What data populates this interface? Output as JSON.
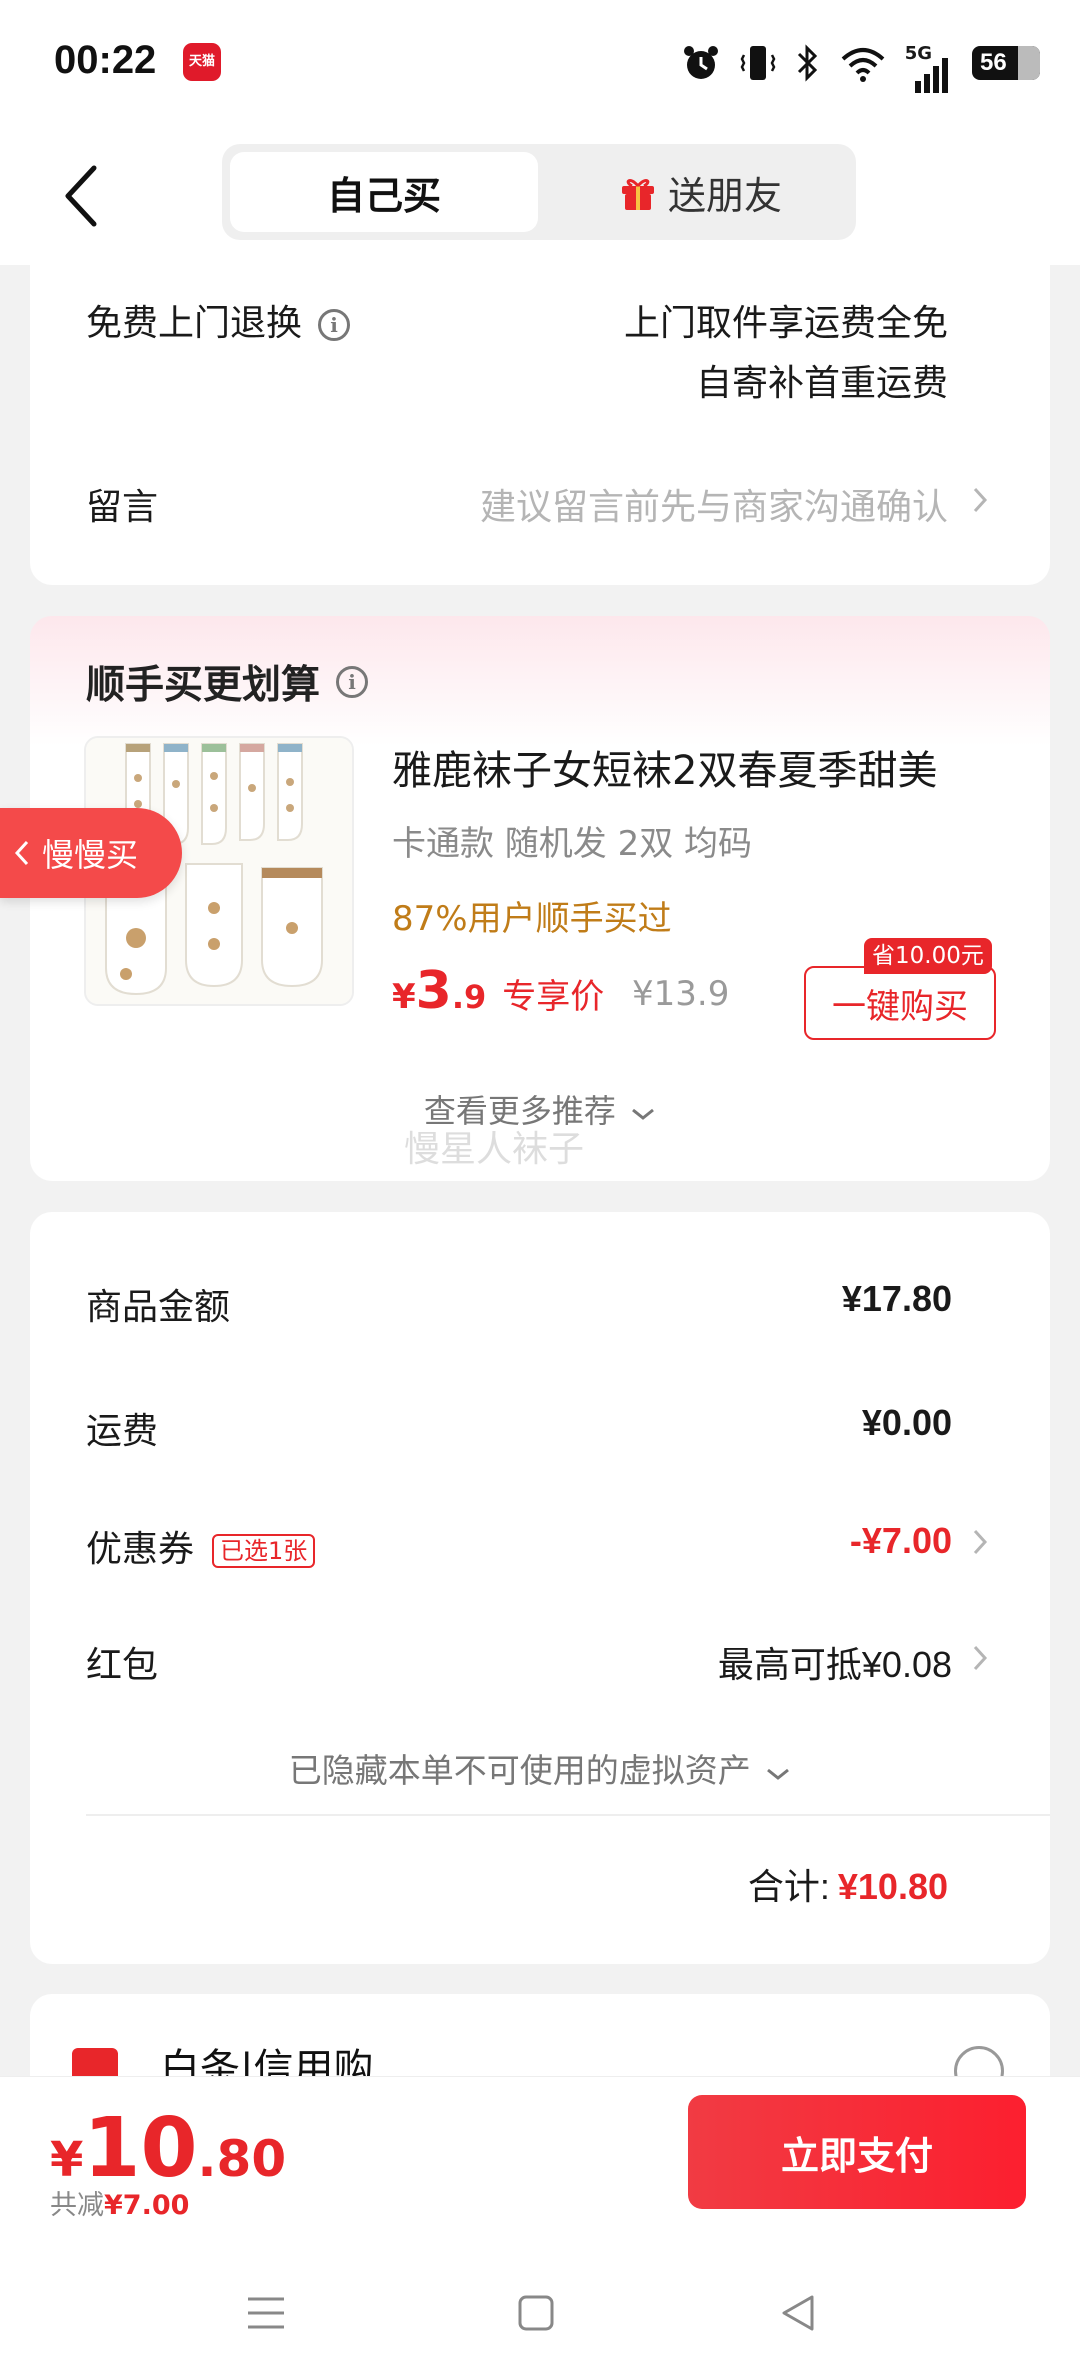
{
  "status_bar": {
    "time": "00:22",
    "app_badge": "天猫",
    "network": "5G",
    "battery": "56"
  },
  "nav": {
    "tab_self": "自己买",
    "tab_gift": "送朋友"
  },
  "service": {
    "free_return_label": "免费上门退换",
    "free_return_line1": "上门取件享运费全免",
    "free_return_line2": "自寄补首重运费",
    "message_label": "留言",
    "message_placeholder": "建议留言前先与商家沟通确认"
  },
  "recommend": {
    "title": "顺手买更划算",
    "product": {
      "name": "雅鹿袜子女短袜2双春夏季甜美",
      "spec": "卡通款 随机发 2双   均码",
      "social": "87%用户顺手买过",
      "currency": "¥",
      "price_int": "3",
      "price_dec": ".9",
      "price_tag": "专享价",
      "original_price": "¥13.9",
      "save_tag": "省10.00元",
      "buy_label": "一键购买"
    },
    "more_label": "查看更多推荐",
    "watermark": "慢星人袜子"
  },
  "float_tab": {
    "label": "慢慢买"
  },
  "summary": {
    "goods_label": "商品金额",
    "goods_value": "¥17.80",
    "shipping_label": "运费",
    "shipping_value": "¥0.00",
    "coupon_label": "优惠券",
    "coupon_badge": "已选1张",
    "coupon_value": "-¥7.00",
    "redpacket_label": "红包",
    "redpacket_value": "最高可抵¥0.08",
    "hidden_assets": "已隐藏本单不可使用的虚拟资产",
    "total_label": "合计:",
    "total_value": "¥10.80"
  },
  "credit": {
    "label": "白条|信用购"
  },
  "bottom": {
    "currency": "¥",
    "total_int": "10",
    "total_dec": ".80",
    "save_prefix": "共减",
    "save_value": "¥7.00",
    "pay_label": "立即支付"
  },
  "colors": {
    "accent": "#e8262a",
    "orange": "#c07c18",
    "bg": "#f2f2f2"
  }
}
